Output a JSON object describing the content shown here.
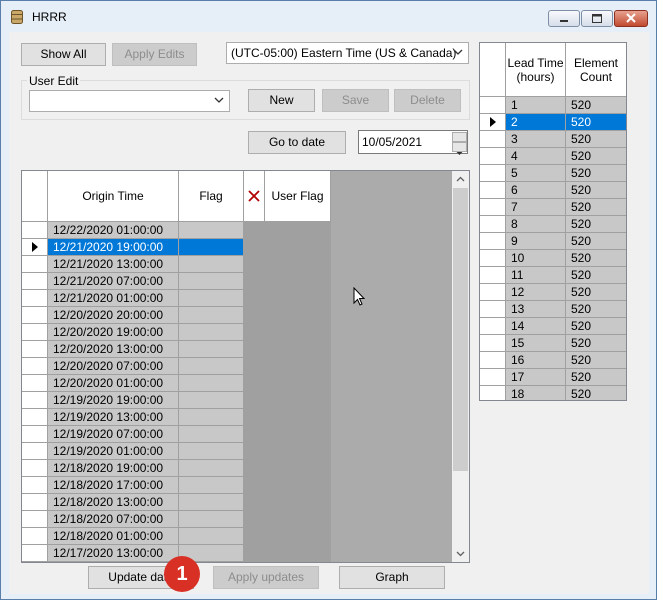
{
  "window": {
    "title": "HRRR"
  },
  "toolbar": {
    "show_all_label": "Show All",
    "apply_edits_label": "Apply Edits",
    "timezone_value": "(UTC-05:00) Eastern Time (US & Canada)"
  },
  "user_edit": {
    "group_label": "User Edit",
    "combo_value": "",
    "new_label": "New",
    "save_label": "Save",
    "delete_label": "Delete"
  },
  "date_nav": {
    "go_to_date_label": "Go to date",
    "date_value": "10/05/2021"
  },
  "origin_grid": {
    "columns": {
      "origin_time": "Origin Time",
      "flag": "Flag",
      "user_flag": "User Flag"
    },
    "selected_index": 1,
    "rows": [
      "12/22/2020 01:00:00",
      "12/21/2020 19:00:00",
      "12/21/2020 13:00:00",
      "12/21/2020 07:00:00",
      "12/21/2020 01:00:00",
      "12/20/2020 20:00:00",
      "12/20/2020 19:00:00",
      "12/20/2020 13:00:00",
      "12/20/2020 07:00:00",
      "12/20/2020 01:00:00",
      "12/19/2020 19:00:00",
      "12/19/2020 13:00:00",
      "12/19/2020 07:00:00",
      "12/19/2020 01:00:00",
      "12/18/2020 19:00:00",
      "12/18/2020 17:00:00",
      "12/18/2020 13:00:00",
      "12/18/2020 07:00:00",
      "12/18/2020 01:00:00",
      "12/17/2020 13:00:00"
    ]
  },
  "lead_grid": {
    "columns": {
      "lead_time": "Lead Time (hours)",
      "element_count": "Element Count"
    },
    "selected_index": 1,
    "rows": [
      {
        "lead": "1",
        "count": "520"
      },
      {
        "lead": "2",
        "count": "520"
      },
      {
        "lead": "3",
        "count": "520"
      },
      {
        "lead": "4",
        "count": "520"
      },
      {
        "lead": "5",
        "count": "520"
      },
      {
        "lead": "6",
        "count": "520"
      },
      {
        "lead": "7",
        "count": "520"
      },
      {
        "lead": "8",
        "count": "520"
      },
      {
        "lead": "9",
        "count": "520"
      },
      {
        "lead": "10",
        "count": "520"
      },
      {
        "lead": "11",
        "count": "520"
      },
      {
        "lead": "12",
        "count": "520"
      },
      {
        "lead": "13",
        "count": "520"
      },
      {
        "lead": "14",
        "count": "520"
      },
      {
        "lead": "15",
        "count": "520"
      },
      {
        "lead": "16",
        "count": "520"
      },
      {
        "lead": "17",
        "count": "520"
      },
      {
        "lead": "18",
        "count": "520"
      }
    ]
  },
  "bottom": {
    "update_data_label": "Update data",
    "apply_updates_label": "Apply updates",
    "graph_label": "Graph"
  },
  "badge": {
    "number": "1"
  },
  "colors": {
    "selection": "#0078d7",
    "badge": "#d93025",
    "delete_x": "#b00000"
  }
}
